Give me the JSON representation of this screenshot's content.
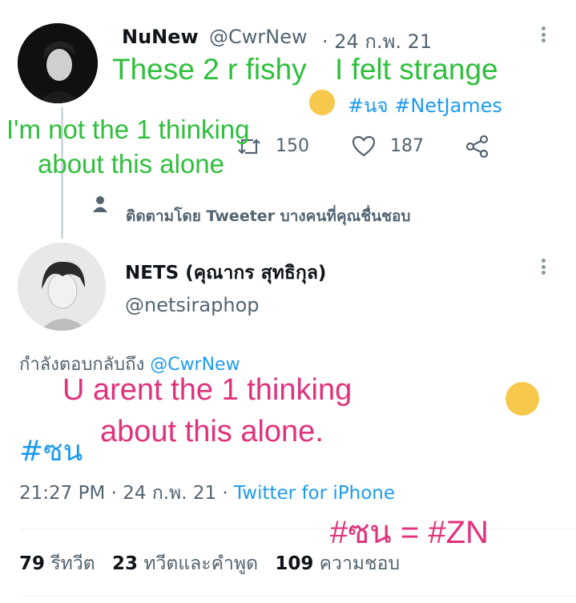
{
  "tweet1": {
    "display_name": "NuNew",
    "handle": "@CwrNew",
    "date": "· 24 ก.พ. 21",
    "hashtags": "#นจ #NetJames",
    "retweet_count": "150",
    "like_count": "187"
  },
  "followed_by": "ติดตามโดย Tweeter บางคนที่คุณชื่นชอบ",
  "tweet2": {
    "display_name": "NETS (คุณากร สุทธิกุล)",
    "handle": "@netsiraphop",
    "replying_prefix": "กำลังตอบกลับถึง",
    "replying_handle": "@CwrNew",
    "hashtag": "#ซน",
    "time": "21:27 PM · 24 ก.พ. 21 ·",
    "source": "Twitter for iPhone",
    "stats": {
      "retweets_num": "79",
      "retweets_label": "รีทวีต",
      "quotes_num": "23",
      "quotes_label": "ทวีตและคำพูด",
      "likes_num": "109",
      "likes_label": "ความชอบ"
    }
  },
  "overlays": {
    "green_line1": "These 2 r fishy",
    "green_line2": "I felt strange",
    "green_line3": "I'm not the 1 thinking",
    "green_line4": "about this alone",
    "pink_line1": "U arent the 1 thinking",
    "pink_line2": "about this alone.",
    "pink_translation": "#ซน = #ZN"
  },
  "colors": {
    "link": "#1d9bf0",
    "green_text": "#2fbf3c",
    "pink_text": "#e0327c"
  }
}
